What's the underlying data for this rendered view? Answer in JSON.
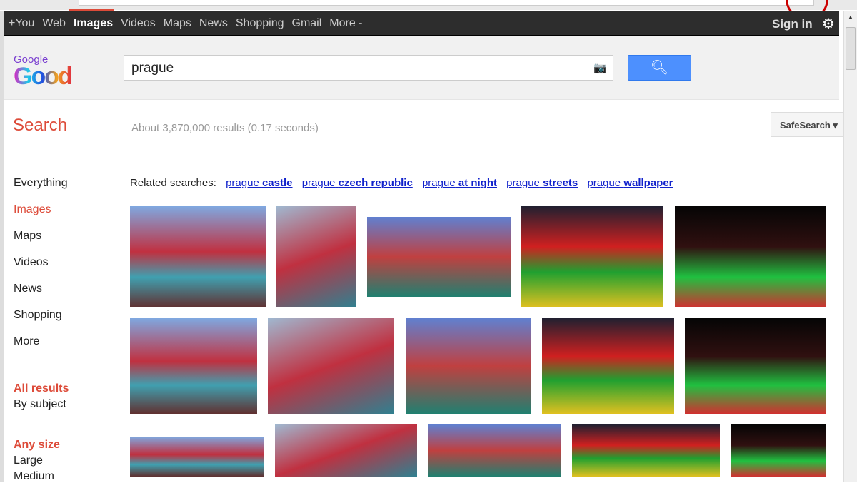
{
  "topbar": {
    "nav": [
      "+You",
      "Web",
      "Images",
      "Videos",
      "Maps",
      "News",
      "Shopping",
      "Gmail",
      "More -"
    ],
    "active": "Images",
    "sign_in": "Sign in"
  },
  "logo": {
    "small": "Google",
    "doodle": "Good"
  },
  "search": {
    "value": "prague"
  },
  "search_label": "Search",
  "stats": "About 3,870,000 results (0.17 seconds)",
  "safesearch": "SafeSearch ▾",
  "sidebar": {
    "types": [
      "Everything",
      "Images",
      "Maps",
      "Videos",
      "News",
      "Shopping",
      "More"
    ],
    "active": "Images",
    "filters1": [
      "All results",
      "By subject"
    ],
    "filters2": [
      "Any size",
      "Large",
      "Medium"
    ]
  },
  "related": {
    "label": "Related searches:",
    "items": [
      {
        "q": "prague",
        "t": "castle"
      },
      {
        "q": "prague",
        "t": "czech republic"
      },
      {
        "q": "prague",
        "t": "at night"
      },
      {
        "q": "prague",
        "t": "streets"
      },
      {
        "q": "prague",
        "t": "wallpaper"
      }
    ]
  },
  "images_count": 15
}
